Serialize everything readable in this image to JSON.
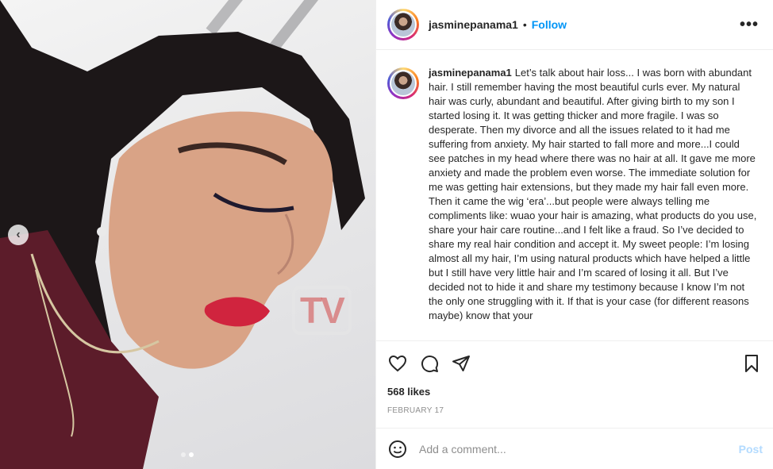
{
  "post": {
    "username": "jasminepanama1",
    "follow_label": "Follow",
    "separator": "•",
    "more_glyph": "•••",
    "caption_user": "jasminepanama1",
    "caption": "Let’s talk about hair loss... I was born with abundant hair. I still remember having the most beautiful curls ever. My natural hair was curly, abundant and beautiful. After giving birth to my son I started losing it. It was getting thicker and more fragile. I was so desperate. Then my divorce and all the issues related to it had me suffering from anxiety. My hair started to fall more and more...I could see patches in my head where there was no hair at all. It gave me more anxiety and made the problem even worse. The immediate solution for me was getting hair extensions, but they made my hair fall even more. Then it came the wig ‘era’...but people were always telling me compliments like: wuao your hair is amazing, what products do you use, share your hair care routine...and I felt like a fraud. So I’ve decided to share my real hair condition and accept it. My sweet people: I’m losing almost all my hair, I’m using natural products which have helped a little but I still have very little hair and I’m scared of losing it all. But I’ve decided not to hide it and share my testimony because I know I’m not the only one struggling with it. If that is your case (for different reasons maybe) know that your",
    "likes": "568 likes",
    "date": "FEBRUARY 17"
  },
  "media": {
    "prev_glyph": "‹",
    "watermark": "TV",
    "slide_count": 2,
    "active_slide": 2
  },
  "comment": {
    "placeholder": "Add a comment...",
    "post_label": "Post"
  },
  "colors": {
    "follow": "#0095f6",
    "post_disabled": "#b3dbff",
    "muted": "#8e8e8e"
  },
  "icons": [
    "heart-icon",
    "comment-icon",
    "share-icon",
    "bookmark-icon",
    "emoji-icon",
    "chevron-left-icon"
  ]
}
